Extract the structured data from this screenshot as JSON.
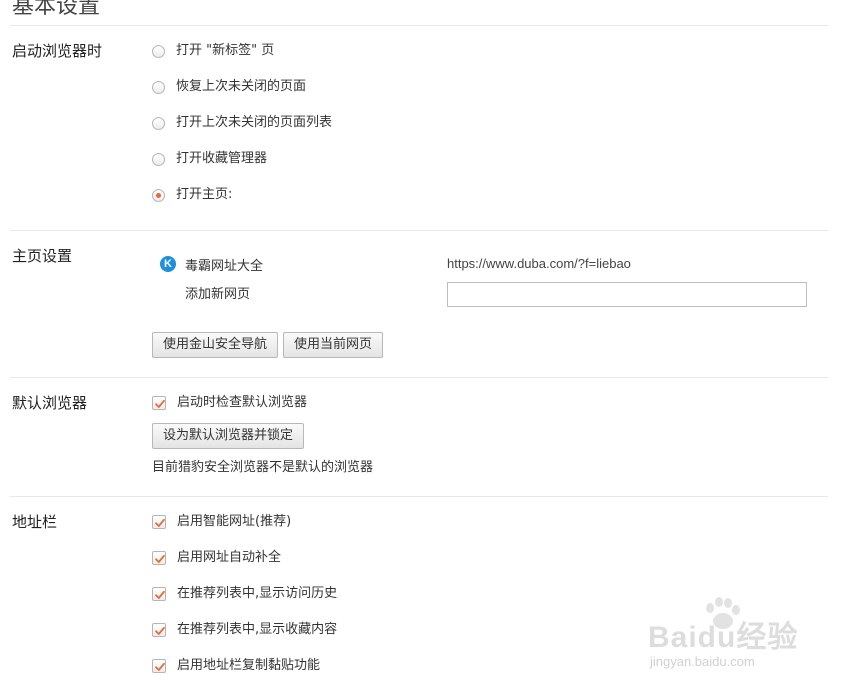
{
  "page": {
    "title": "基本设置"
  },
  "startup": {
    "title": "启动浏览器时",
    "options": [
      {
        "label": "打开 \"新标签\" 页",
        "checked": false
      },
      {
        "label": "恢复上次未关闭的页面",
        "checked": false
      },
      {
        "label": "打开上次未关闭的页面列表",
        "checked": false
      },
      {
        "label": "打开收藏管理器",
        "checked": false
      },
      {
        "label": "打开主页:",
        "checked": true
      }
    ]
  },
  "homepage": {
    "title": "主页设置",
    "site_icon": "k-logo-icon",
    "site_icon_letter": "K",
    "site_name": "毒霸网址大全",
    "site_url": "https://www.duba.com/?f=liebao",
    "add_label": "添加新网页",
    "add_input_value": "",
    "btn_kingsoft_nav": "使用金山安全导航",
    "btn_current_page": "使用当前网页"
  },
  "default_browser": {
    "title": "默认浏览器",
    "check_on_start_label": "启动时检查默认浏览器",
    "check_on_start_checked": true,
    "set_default_btn": "设为默认浏览器并锁定",
    "status": "目前猎豹安全浏览器不是默认的浏览器"
  },
  "address_bar": {
    "title": "地址栏",
    "options": [
      {
        "label": "启用智能网址(推荐)",
        "checked": true
      },
      {
        "label": "启用网址自动补全",
        "checked": true
      },
      {
        "label": "在推荐列表中,显示访问历史",
        "checked": true
      },
      {
        "label": "在推荐列表中,显示收藏内容",
        "checked": true
      },
      {
        "label": "启用地址栏复制黏贴功能",
        "checked": true
      }
    ]
  },
  "watermark": {
    "brand": "Baidu经验",
    "domain": "jingyan.baidu.com"
  },
  "colors": {
    "accent": "#e8693a",
    "icon_blue": "#1e8fe0",
    "divider": "#e8e8e8"
  }
}
